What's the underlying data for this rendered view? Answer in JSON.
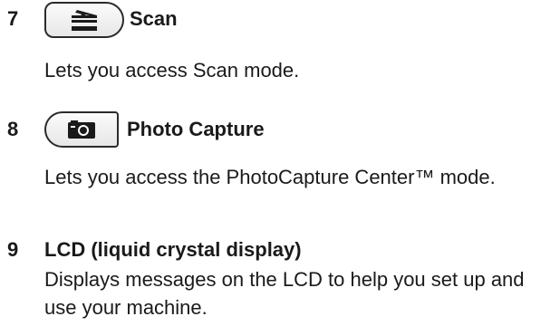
{
  "items": [
    {
      "number": "7",
      "key_icon": "scan-icon",
      "title": "Scan",
      "description": "Lets you access Scan mode."
    },
    {
      "number": "8",
      "key_icon": "camera-icon",
      "title": "Photo Capture",
      "description": "Lets you access the PhotoCapture Center™ mode."
    },
    {
      "number": "9",
      "title": "LCD (liquid crystal display)",
      "description": "Displays messages on the LCD to help you set up and use your machine."
    }
  ]
}
